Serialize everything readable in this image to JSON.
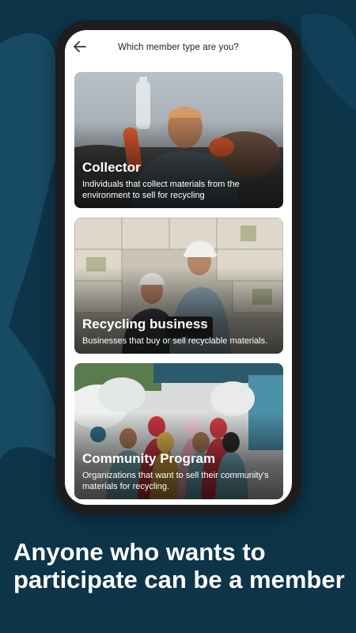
{
  "header": {
    "title": "Which member type are you?",
    "back_icon": "arrow-left-icon"
  },
  "cards": [
    {
      "title": "Collector",
      "description": "Individuals that collect materials from the environment to sell for recycling"
    },
    {
      "title": "Recycling business",
      "description": "Businesses that buy or sell recyclable materials."
    },
    {
      "title": "Community Program",
      "description": "Organizations that want to sell their community's materials for recycling."
    }
  ],
  "caption": "Anyone who wants to participate can be a member",
  "colors": {
    "background": "#0d3448",
    "accent_shape": "#174a63",
    "phone_frame": "#1d1d1f"
  }
}
